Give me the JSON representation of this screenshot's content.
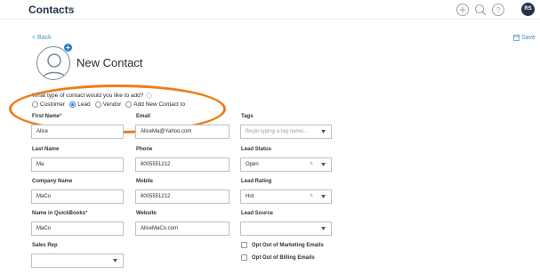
{
  "header": {
    "app_title": "Contacts",
    "avatar_initials": "RS"
  },
  "nav": {
    "back_label": "< Back",
    "save_label": "Save"
  },
  "page": {
    "title": "New Contact"
  },
  "contact_type": {
    "question": "What type of contact would you like to add?",
    "options": [
      "Customer",
      "Lead",
      "Vendor",
      "Add New Contact to"
    ],
    "selected": "Lead"
  },
  "form": {
    "first_name": {
      "label": "First Name",
      "required": "*",
      "value": "Alice"
    },
    "last_name": {
      "label": "Last Name",
      "value": "Ma"
    },
    "company_name": {
      "label": "Company Name",
      "value": "MaCo"
    },
    "name_in_qb": {
      "label": "Name in QuickBooks",
      "required": "*",
      "value": "MaCo"
    },
    "sales_rep": {
      "label": "Sales Rep",
      "value": ""
    },
    "email": {
      "label": "Email",
      "value": "AliceMa@Yahoo.com"
    },
    "phone": {
      "label": "Phone",
      "value": "8005551212"
    },
    "mobile": {
      "label": "Mobile",
      "value": "8005551212"
    },
    "website": {
      "label": "Website",
      "value": "AliceMaCo.com"
    },
    "tags": {
      "label": "Tags",
      "placeholder": "Begin typing a tag name..."
    },
    "lead_status": {
      "label": "Lead Status",
      "value": "Open"
    },
    "lead_rating": {
      "label": "Lead Rating",
      "value": "Hot"
    },
    "lead_source": {
      "label": "Lead Source",
      "value": ""
    },
    "opt_out_marketing": {
      "label": "Opt Out of Marketing Emails"
    },
    "opt_out_billing": {
      "label": "Opt Out of Billing Emails"
    }
  },
  "colors": {
    "accent": "#2c7bd2",
    "highlight": "#f07c18",
    "title": "#1f3349"
  }
}
